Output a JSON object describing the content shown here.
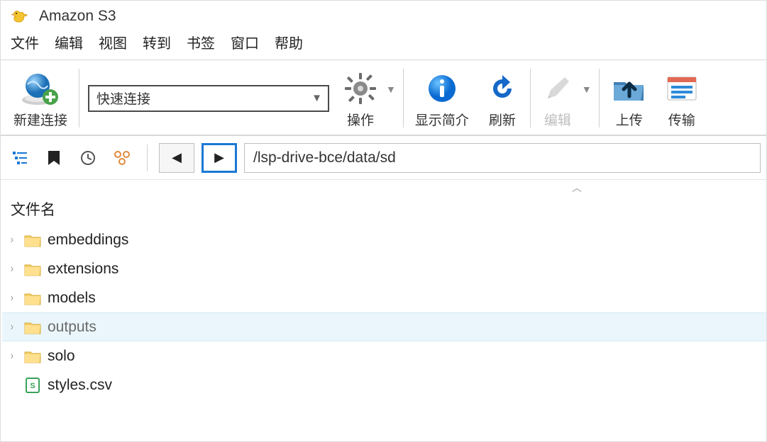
{
  "window": {
    "title": "Amazon S3"
  },
  "menu": {
    "file": "文件",
    "edit": "编辑",
    "view": "视图",
    "go": "转到",
    "bookmarks": "书签",
    "window": "窗口",
    "help": "帮助"
  },
  "toolbar": {
    "new_connection": "新建连接",
    "quick_connect_value": "快速连接",
    "action": "操作",
    "get_info": "显示简介",
    "refresh": "刷新",
    "edit": "编辑",
    "upload": "上传",
    "transfers": "传输"
  },
  "nav": {
    "path_value": "/lsp-drive-bce/data/sd"
  },
  "columns": {
    "name": "文件名"
  },
  "tree": {
    "items": [
      {
        "name": "embeddings",
        "type": "folder",
        "expandable": true,
        "selected": false
      },
      {
        "name": "extensions",
        "type": "folder",
        "expandable": true,
        "selected": false
      },
      {
        "name": "models",
        "type": "folder",
        "expandable": true,
        "selected": false
      },
      {
        "name": "outputs",
        "type": "folder",
        "expandable": true,
        "selected": true
      },
      {
        "name": "solo",
        "type": "folder",
        "expandable": true,
        "selected": false
      },
      {
        "name": "styles.csv",
        "type": "file",
        "expandable": false,
        "selected": false
      }
    ]
  }
}
